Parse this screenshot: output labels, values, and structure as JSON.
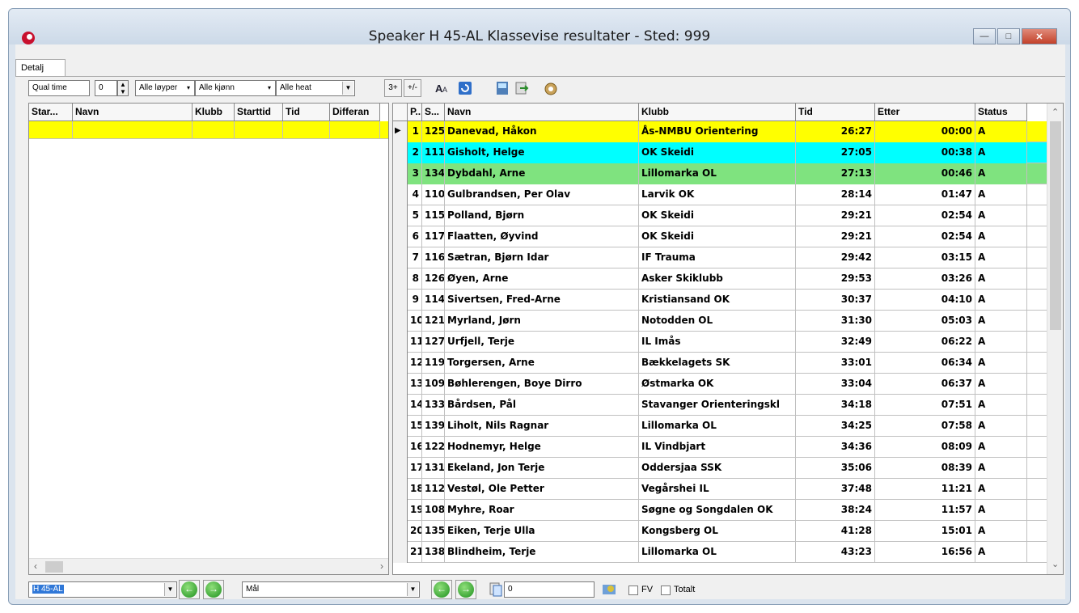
{
  "window": {
    "title": "Speaker  H 45-AL Klassevise resultater - Sted: 999"
  },
  "tabs": [
    {
      "label": "Detalj"
    }
  ],
  "toolbar": {
    "qual_time_label": "Qual time",
    "qual_value": "0",
    "filter_runners": "Alle løyper",
    "filter_gender": "Alle kjønn",
    "filter_heat": "Alle heat",
    "btn_3plus": "3+",
    "btn_plusminus": "+/-"
  },
  "left_grid": {
    "columns": [
      "Star...",
      "Navn",
      "Klubb",
      "Starttid",
      "Tid",
      "Differan"
    ]
  },
  "right_grid": {
    "columns": [
      "P...",
      "S...",
      "Navn",
      "Klubb",
      "Tid",
      "Etter",
      "Status"
    ],
    "highlight_colors": {
      "first": "#ffff00",
      "second": "#00ffff",
      "third": "#7fe37f"
    },
    "rows": [
      {
        "pos": "1",
        "start": "125",
        "name": "Danevad, Håkon",
        "club": "Ås-NMBU Orientering",
        "time": "26:27",
        "behind": "00:00",
        "status": "A"
      },
      {
        "pos": "2",
        "start": "111",
        "name": "Gisholt, Helge",
        "club": "OK Skeidi",
        "time": "27:05",
        "behind": "00:38",
        "status": "A"
      },
      {
        "pos": "3",
        "start": "134",
        "name": "Dybdahl, Arne",
        "club": "Lillomarka OL",
        "time": "27:13",
        "behind": "00:46",
        "status": "A"
      },
      {
        "pos": "4",
        "start": "110",
        "name": "Gulbrandsen, Per Olav",
        "club": "Larvik OK",
        "time": "28:14",
        "behind": "01:47",
        "status": "A"
      },
      {
        "pos": "5",
        "start": "115",
        "name": "Polland, Bjørn",
        "club": "OK Skeidi",
        "time": "29:21",
        "behind": "02:54",
        "status": "A"
      },
      {
        "pos": "6",
        "start": "117",
        "name": "Flaatten, Øyvind",
        "club": "OK Skeidi",
        "time": "29:21",
        "behind": "02:54",
        "status": "A"
      },
      {
        "pos": "7",
        "start": "116",
        "name": "Sætran, Bjørn Idar",
        "club": "IF Trauma",
        "time": "29:42",
        "behind": "03:15",
        "status": "A"
      },
      {
        "pos": "8",
        "start": "126",
        "name": "Øyen, Arne",
        "club": "Asker Skiklubb",
        "time": "29:53",
        "behind": "03:26",
        "status": "A"
      },
      {
        "pos": "9",
        "start": "114",
        "name": "Sivertsen, Fred-Arne",
        "club": "Kristiansand OK",
        "time": "30:37",
        "behind": "04:10",
        "status": "A"
      },
      {
        "pos": "10",
        "start": "121",
        "name": "Myrland, Jørn",
        "club": "Notodden OL",
        "time": "31:30",
        "behind": "05:03",
        "status": "A"
      },
      {
        "pos": "11",
        "start": "127",
        "name": "Urfjell, Terje",
        "club": "IL Imås",
        "time": "32:49",
        "behind": "06:22",
        "status": "A"
      },
      {
        "pos": "12",
        "start": "119",
        "name": "Torgersen, Arne",
        "club": "Bækkelagets SK",
        "time": "33:01",
        "behind": "06:34",
        "status": "A"
      },
      {
        "pos": "13",
        "start": "109",
        "name": "Bøhlerengen, Boye Dirro",
        "club": "Østmarka OK",
        "time": "33:04",
        "behind": "06:37",
        "status": "A"
      },
      {
        "pos": "14",
        "start": "133",
        "name": "Bårdsen, Pål",
        "club": "Stavanger Orienteringskl",
        "time": "34:18",
        "behind": "07:51",
        "status": "A"
      },
      {
        "pos": "15",
        "start": "139",
        "name": "Liholt, Nils Ragnar",
        "club": "Lillomarka OL",
        "time": "34:25",
        "behind": "07:58",
        "status": "A"
      },
      {
        "pos": "16",
        "start": "122",
        "name": "Hodnemyr, Helge",
        "club": "IL Vindbjart",
        "time": "34:36",
        "behind": "08:09",
        "status": "A"
      },
      {
        "pos": "17",
        "start": "131",
        "name": "Ekeland, Jon Terje",
        "club": "Oddersjaa SSK",
        "time": "35:06",
        "behind": "08:39",
        "status": "A"
      },
      {
        "pos": "18",
        "start": "112",
        "name": "Vestøl, Ole Petter",
        "club": "Vegårshei IL",
        "time": "37:48",
        "behind": "11:21",
        "status": "A"
      },
      {
        "pos": "19",
        "start": "108",
        "name": "Myhre, Roar",
        "club": "Søgne og Songdalen OK",
        "time": "38:24",
        "behind": "11:57",
        "status": "A"
      },
      {
        "pos": "20",
        "start": "135",
        "name": "Eiken, Terje Ulla",
        "club": "Kongsberg OL",
        "time": "41:28",
        "behind": "15:01",
        "status": "A"
      },
      {
        "pos": "21",
        "start": "138",
        "name": "Blindheim, Terje",
        "club": "Lillomarka OL",
        "time": "43:23",
        "behind": "16:56",
        "status": "A"
      }
    ]
  },
  "bottom": {
    "class_value": "H 45-AL",
    "control_value": "Mål",
    "number_value": "0",
    "fv_label": "FV",
    "total_label": "Totalt"
  }
}
